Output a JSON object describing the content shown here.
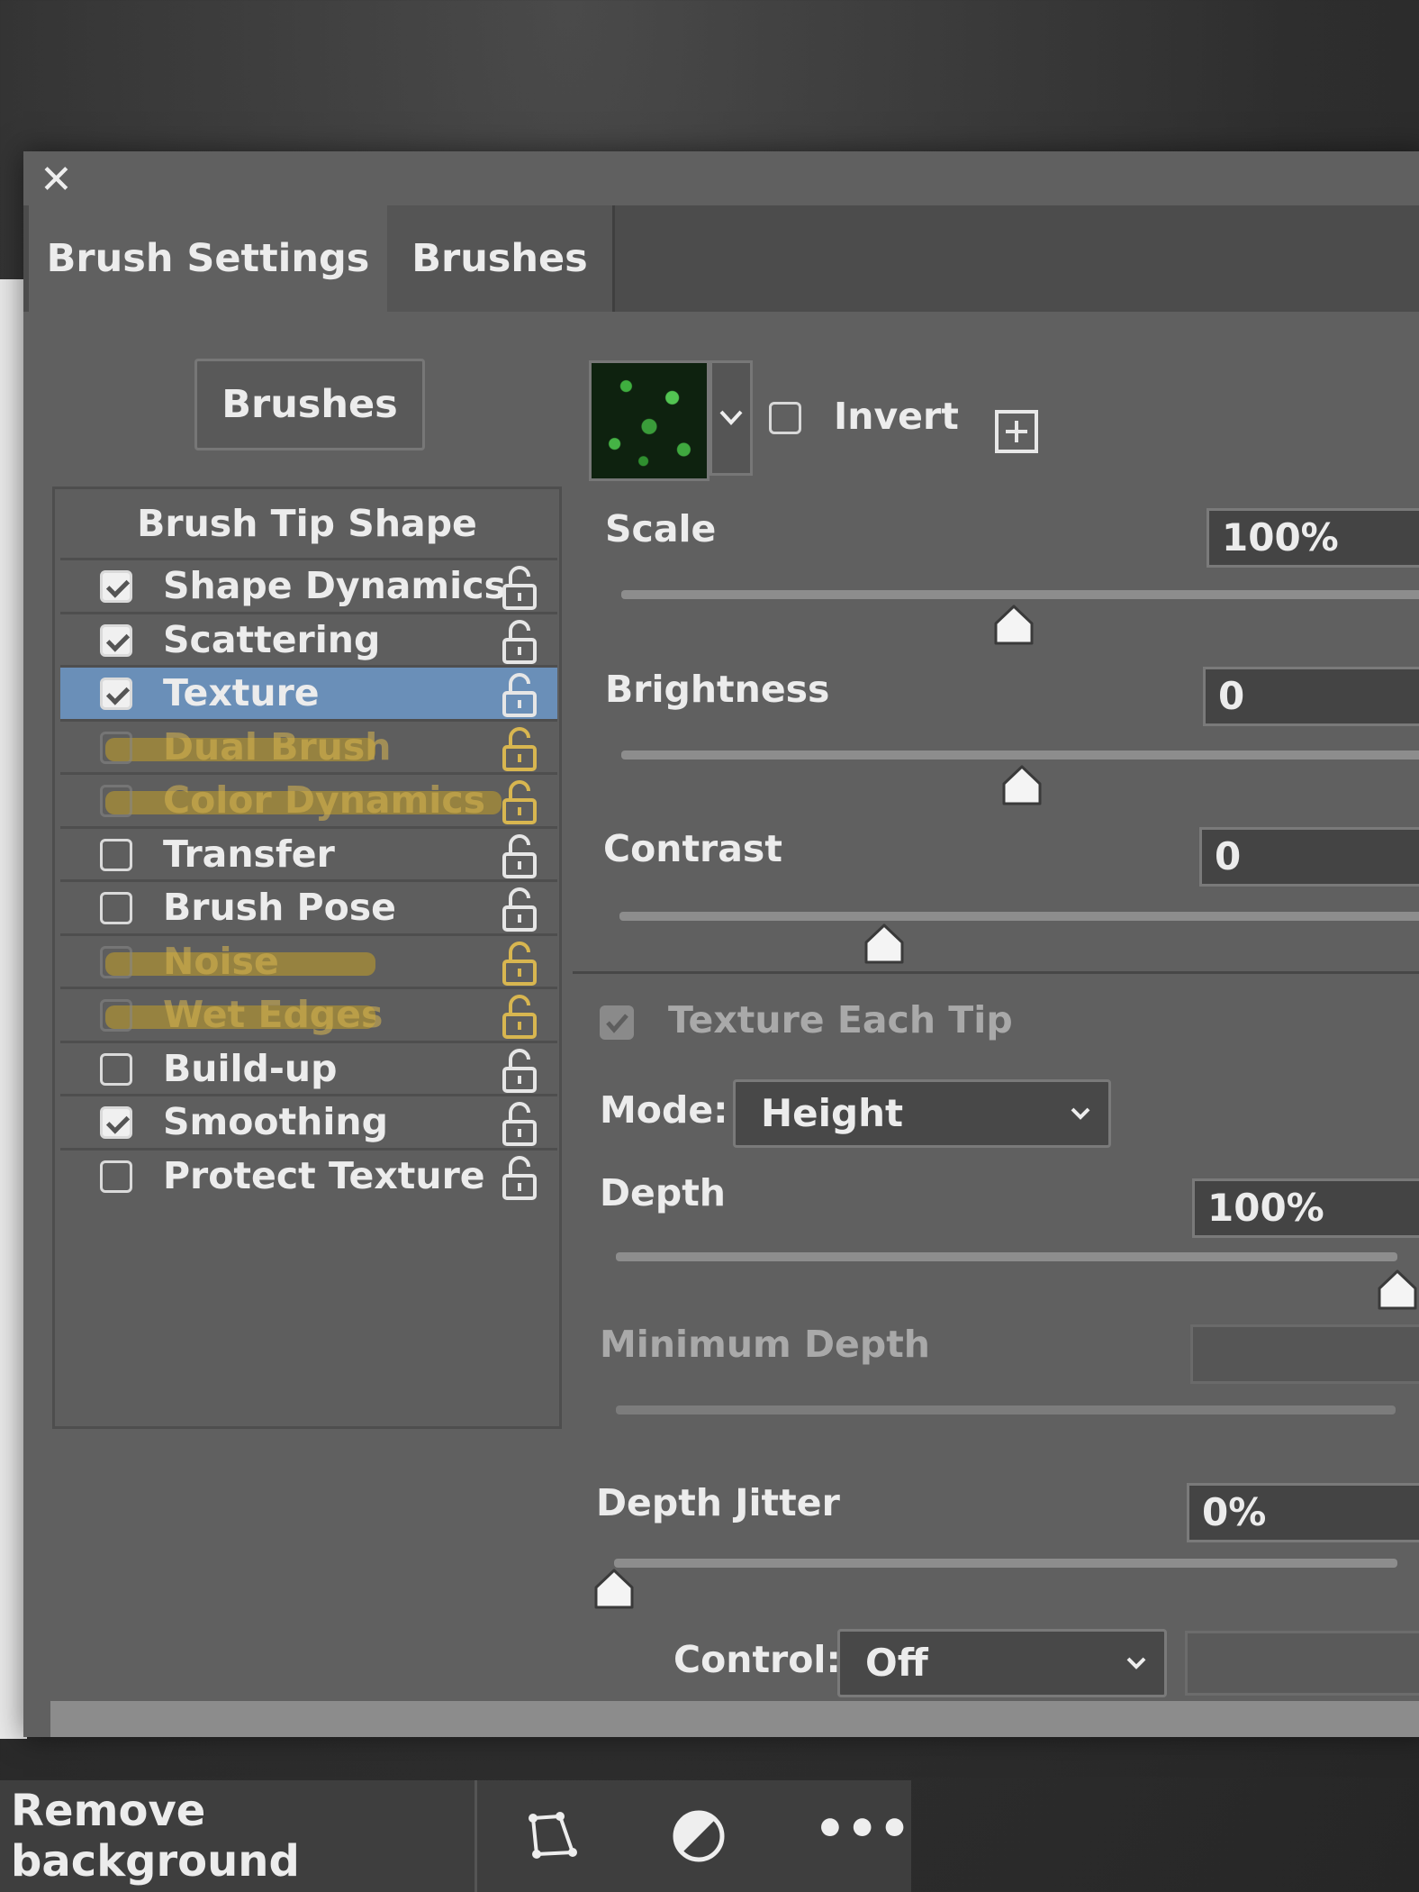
{
  "tabs": {
    "active": "Brush Settings",
    "other": "Brushes"
  },
  "close_icon": "close-icon",
  "brushes_button": "Brushes",
  "options_header": "Brush Tip Shape",
  "options": [
    {
      "label": "Shape Dynamics",
      "checked": true,
      "state": "normal"
    },
    {
      "label": "Scattering",
      "checked": true,
      "state": "normal"
    },
    {
      "label": "Texture",
      "checked": true,
      "state": "selected"
    },
    {
      "label": "Dual Brush",
      "checked": false,
      "state": "disabled-highlighted"
    },
    {
      "label": "Color Dynamics",
      "checked": false,
      "state": "disabled-highlighted"
    },
    {
      "label": "Transfer",
      "checked": false,
      "state": "normal"
    },
    {
      "label": "Brush Pose",
      "checked": false,
      "state": "normal"
    },
    {
      "label": "Noise",
      "checked": false,
      "state": "disabled-highlighted"
    },
    {
      "label": "Wet Edges",
      "checked": false,
      "state": "disabled-highlighted"
    },
    {
      "label": "Build-up",
      "checked": false,
      "state": "normal"
    },
    {
      "label": "Smoothing",
      "checked": true,
      "state": "normal"
    },
    {
      "label": "Protect Texture",
      "checked": false,
      "state": "normal"
    }
  ],
  "texture": {
    "invert_label": "Invert",
    "invert_checked": false,
    "scale": {
      "label": "Scale",
      "value": "100%",
      "slider": 0.49
    },
    "brightness": {
      "label": "Brightness",
      "value": "0",
      "slider": 0.5
    },
    "contrast": {
      "label": "Contrast",
      "value": "0",
      "slider": 0.33
    },
    "texture_each_tip": {
      "label": "Texture Each Tip",
      "checked": true
    },
    "mode": {
      "label": "Mode:",
      "value": "Height"
    },
    "depth": {
      "label": "Depth",
      "value": "100%",
      "slider": 1.0
    },
    "minimum_depth": {
      "label": "Minimum Depth",
      "value": ""
    },
    "depth_jitter": {
      "label": "Depth Jitter",
      "value": "0%",
      "slider": 0.0
    },
    "control": {
      "label": "Control:",
      "value": "Off"
    }
  },
  "bottom_bar": {
    "remove_background": "Remove background"
  },
  "colors": {
    "panel": "#606060",
    "selected_row": "#6a8fb8",
    "highlighter": "#c4a028"
  }
}
